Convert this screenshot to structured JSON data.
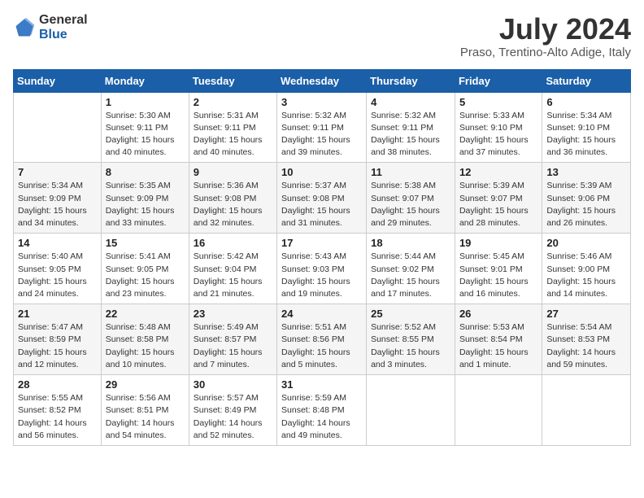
{
  "logo": {
    "general": "General",
    "blue": "Blue"
  },
  "title": "July 2024",
  "location": "Praso, Trentino-Alto Adige, Italy",
  "days": [
    "Sunday",
    "Monday",
    "Tuesday",
    "Wednesday",
    "Thursday",
    "Friday",
    "Saturday"
  ],
  "weeks": [
    [
      {
        "day": "",
        "info": ""
      },
      {
        "day": "1",
        "info": "Sunrise: 5:30 AM\nSunset: 9:11 PM\nDaylight: 15 hours\nand 40 minutes."
      },
      {
        "day": "2",
        "info": "Sunrise: 5:31 AM\nSunset: 9:11 PM\nDaylight: 15 hours\nand 40 minutes."
      },
      {
        "day": "3",
        "info": "Sunrise: 5:32 AM\nSunset: 9:11 PM\nDaylight: 15 hours\nand 39 minutes."
      },
      {
        "day": "4",
        "info": "Sunrise: 5:32 AM\nSunset: 9:11 PM\nDaylight: 15 hours\nand 38 minutes."
      },
      {
        "day": "5",
        "info": "Sunrise: 5:33 AM\nSunset: 9:10 PM\nDaylight: 15 hours\nand 37 minutes."
      },
      {
        "day": "6",
        "info": "Sunrise: 5:34 AM\nSunset: 9:10 PM\nDaylight: 15 hours\nand 36 minutes."
      }
    ],
    [
      {
        "day": "7",
        "info": "Sunrise: 5:34 AM\nSunset: 9:09 PM\nDaylight: 15 hours\nand 34 minutes."
      },
      {
        "day": "8",
        "info": "Sunrise: 5:35 AM\nSunset: 9:09 PM\nDaylight: 15 hours\nand 33 minutes."
      },
      {
        "day": "9",
        "info": "Sunrise: 5:36 AM\nSunset: 9:08 PM\nDaylight: 15 hours\nand 32 minutes."
      },
      {
        "day": "10",
        "info": "Sunrise: 5:37 AM\nSunset: 9:08 PM\nDaylight: 15 hours\nand 31 minutes."
      },
      {
        "day": "11",
        "info": "Sunrise: 5:38 AM\nSunset: 9:07 PM\nDaylight: 15 hours\nand 29 minutes."
      },
      {
        "day": "12",
        "info": "Sunrise: 5:39 AM\nSunset: 9:07 PM\nDaylight: 15 hours\nand 28 minutes."
      },
      {
        "day": "13",
        "info": "Sunrise: 5:39 AM\nSunset: 9:06 PM\nDaylight: 15 hours\nand 26 minutes."
      }
    ],
    [
      {
        "day": "14",
        "info": "Sunrise: 5:40 AM\nSunset: 9:05 PM\nDaylight: 15 hours\nand 24 minutes."
      },
      {
        "day": "15",
        "info": "Sunrise: 5:41 AM\nSunset: 9:05 PM\nDaylight: 15 hours\nand 23 minutes."
      },
      {
        "day": "16",
        "info": "Sunrise: 5:42 AM\nSunset: 9:04 PM\nDaylight: 15 hours\nand 21 minutes."
      },
      {
        "day": "17",
        "info": "Sunrise: 5:43 AM\nSunset: 9:03 PM\nDaylight: 15 hours\nand 19 minutes."
      },
      {
        "day": "18",
        "info": "Sunrise: 5:44 AM\nSunset: 9:02 PM\nDaylight: 15 hours\nand 17 minutes."
      },
      {
        "day": "19",
        "info": "Sunrise: 5:45 AM\nSunset: 9:01 PM\nDaylight: 15 hours\nand 16 minutes."
      },
      {
        "day": "20",
        "info": "Sunrise: 5:46 AM\nSunset: 9:00 PM\nDaylight: 15 hours\nand 14 minutes."
      }
    ],
    [
      {
        "day": "21",
        "info": "Sunrise: 5:47 AM\nSunset: 8:59 PM\nDaylight: 15 hours\nand 12 minutes."
      },
      {
        "day": "22",
        "info": "Sunrise: 5:48 AM\nSunset: 8:58 PM\nDaylight: 15 hours\nand 10 minutes."
      },
      {
        "day": "23",
        "info": "Sunrise: 5:49 AM\nSunset: 8:57 PM\nDaylight: 15 hours\nand 7 minutes."
      },
      {
        "day": "24",
        "info": "Sunrise: 5:51 AM\nSunset: 8:56 PM\nDaylight: 15 hours\nand 5 minutes."
      },
      {
        "day": "25",
        "info": "Sunrise: 5:52 AM\nSunset: 8:55 PM\nDaylight: 15 hours\nand 3 minutes."
      },
      {
        "day": "26",
        "info": "Sunrise: 5:53 AM\nSunset: 8:54 PM\nDaylight: 15 hours\nand 1 minute."
      },
      {
        "day": "27",
        "info": "Sunrise: 5:54 AM\nSunset: 8:53 PM\nDaylight: 14 hours\nand 59 minutes."
      }
    ],
    [
      {
        "day": "28",
        "info": "Sunrise: 5:55 AM\nSunset: 8:52 PM\nDaylight: 14 hours\nand 56 minutes."
      },
      {
        "day": "29",
        "info": "Sunrise: 5:56 AM\nSunset: 8:51 PM\nDaylight: 14 hours\nand 54 minutes."
      },
      {
        "day": "30",
        "info": "Sunrise: 5:57 AM\nSunset: 8:49 PM\nDaylight: 14 hours\nand 52 minutes."
      },
      {
        "day": "31",
        "info": "Sunrise: 5:59 AM\nSunset: 8:48 PM\nDaylight: 14 hours\nand 49 minutes."
      },
      {
        "day": "",
        "info": ""
      },
      {
        "day": "",
        "info": ""
      },
      {
        "day": "",
        "info": ""
      }
    ]
  ]
}
